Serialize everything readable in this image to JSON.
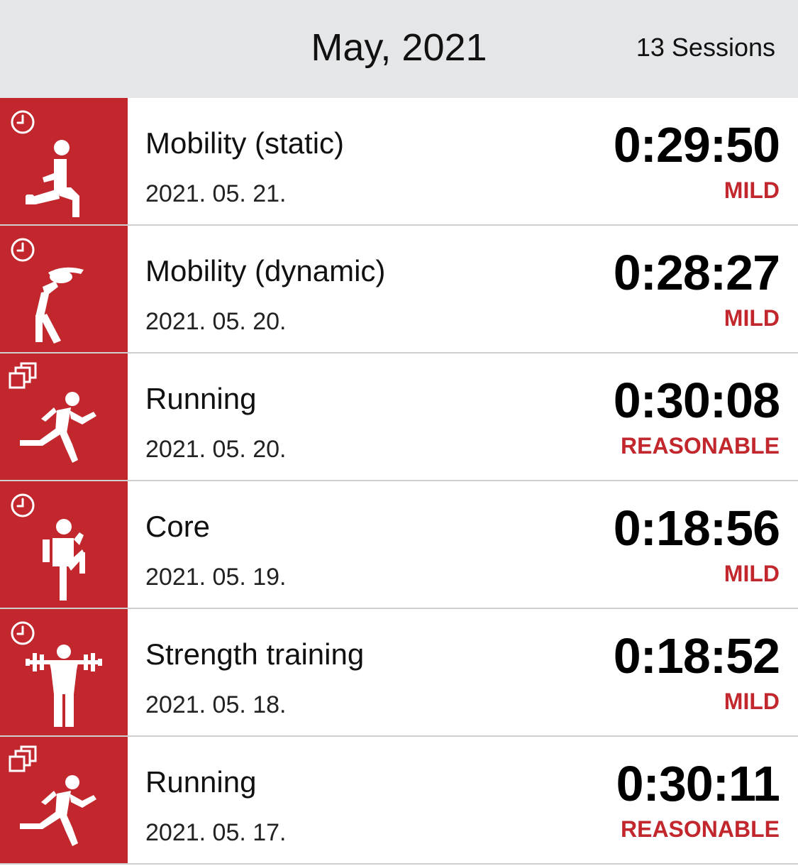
{
  "header": {
    "title": "May, 2021",
    "session_count": "13 Sessions"
  },
  "colors": {
    "tile_background": "#c1272d",
    "intensity_text": "#c1272d",
    "header_background": "#e5e6e8"
  },
  "sessions": [
    {
      "badge_icon": "clock-icon",
      "activity_icon": "lunge-stretch-icon",
      "name": "Mobility (static)",
      "date": "2021. 05. 21.",
      "duration": "0:29:50",
      "intensity": "MILD"
    },
    {
      "badge_icon": "clock-icon",
      "activity_icon": "side-stretch-icon",
      "name": "Mobility (dynamic)",
      "date": "2021. 05. 20.",
      "duration": "0:28:27",
      "intensity": "MILD"
    },
    {
      "badge_icon": "multi-window-icon",
      "activity_icon": "running-icon",
      "name": "Running",
      "date": "2021. 05. 20.",
      "duration": "0:30:08",
      "intensity": "REASONABLE"
    },
    {
      "badge_icon": "clock-icon",
      "activity_icon": "knee-raise-icon",
      "name": "Core",
      "date": "2021. 05. 19.",
      "duration": "0:18:56",
      "intensity": "MILD"
    },
    {
      "badge_icon": "clock-icon",
      "activity_icon": "barbell-squat-icon",
      "name": "Strength training",
      "date": "2021. 05. 18.",
      "duration": "0:18:52",
      "intensity": "MILD"
    },
    {
      "badge_icon": "multi-window-icon",
      "activity_icon": "running-icon",
      "name": "Running",
      "date": "2021. 05. 17.",
      "duration": "0:30:11",
      "intensity": "REASONABLE"
    }
  ]
}
